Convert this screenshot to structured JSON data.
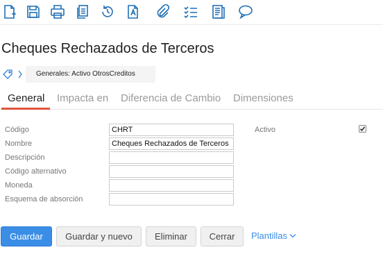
{
  "toolbar": {
    "icons": [
      "new-document-icon",
      "save-icon",
      "print-icon",
      "copy-icon",
      "history-icon",
      "text-document-icon",
      "attachment-icon",
      "checklist-icon",
      "notes-icon",
      "comment-icon"
    ],
    "icon_color": "#1f6fb5"
  },
  "header": {
    "title": "Cheques Rechazados de Terceros"
  },
  "breadcrumb": {
    "chip": "Generales: Activo OtrosCreditos"
  },
  "tabs": [
    {
      "label": "General",
      "active": true
    },
    {
      "label": "Impacta en",
      "active": false
    },
    {
      "label": "Diferencia de Cambio",
      "active": false
    },
    {
      "label": "Dimensiones",
      "active": false
    }
  ],
  "form": {
    "fields": [
      {
        "label": "Código",
        "value": "CHRT"
      },
      {
        "label": "Nombre",
        "value": "Cheques Rechazados de Terceros"
      },
      {
        "label": "Descripción",
        "value": ""
      },
      {
        "label": "Código alternativo",
        "value": ""
      },
      {
        "label": "Moneda",
        "value": ""
      },
      {
        "label": "Esquema de absorción",
        "value": ""
      }
    ],
    "activo": {
      "label": "Activo",
      "checked": true
    }
  },
  "actions": {
    "save": "Guardar",
    "save_new": "Guardar y nuevo",
    "delete": "Eliminar",
    "close": "Cerrar",
    "templates": "Plantillas"
  },
  "colors": {
    "primary": "#3a8ee6",
    "tab_accent": "#e0533a",
    "icon": "#1f6fb5"
  }
}
